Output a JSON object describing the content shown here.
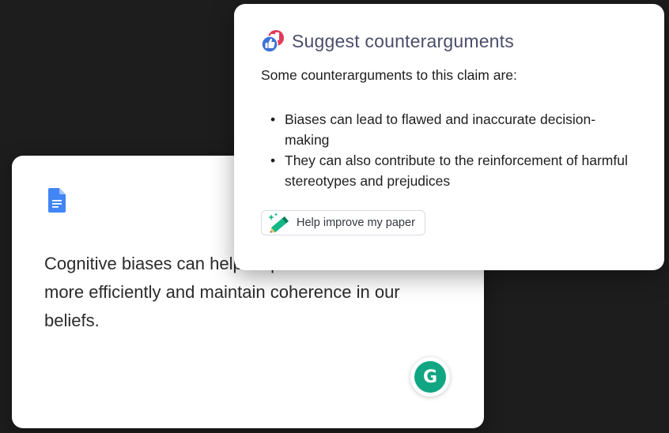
{
  "document": {
    "app_icon": "google-docs-icon",
    "text": "Cognitive biases can help us process information more efficiently and maintain coherence in our beliefs.",
    "assistant_button_icon": "grammarly-icon",
    "assistant_button_glyph": "G"
  },
  "suggestion": {
    "icon": "thumbs-up-down-icon",
    "title": "Suggest counterarguments",
    "intro": "Some counterarguments to this claim are:",
    "items": [
      "Biases can lead to flawed and inaccurate decision-making",
      "They can also contribute to the reinforcement of harmful stereotypes and prejudices"
    ],
    "action": {
      "icon": "pencil-sparkle-icon",
      "label": "Help improve my paper"
    }
  },
  "colors": {
    "background": "#1d1d1d",
    "card": "#ffffff",
    "title": "#4a4e6a",
    "grammarly_green": "#11a683",
    "docs_blue": "#4285f4",
    "thumbs_red": "#e23b5a",
    "thumbs_blue": "#3d6fd6"
  }
}
